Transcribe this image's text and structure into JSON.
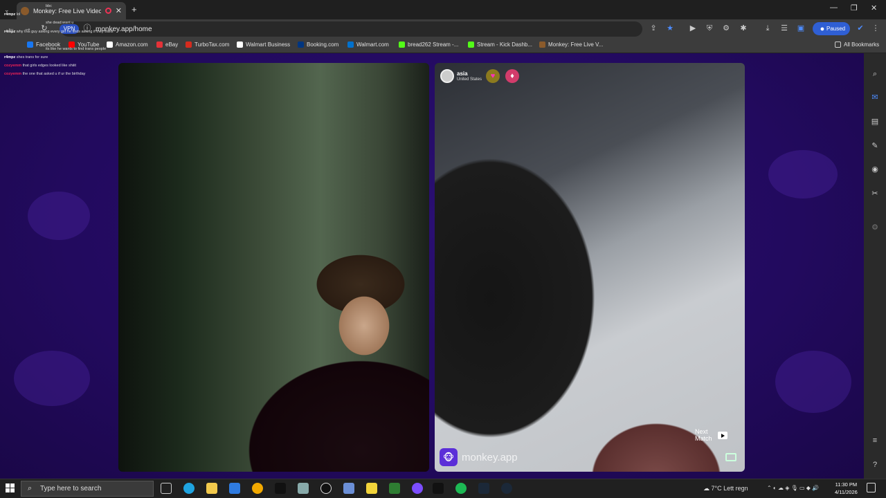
{
  "browser": {
    "tab": {
      "title": "Monkey: Free Live Video Ch",
      "close": "✕"
    },
    "new_tab": "+",
    "window_controls": {
      "minimize": "—",
      "maximize": "❐",
      "close": "✕"
    },
    "address": {
      "vpn_label": "VPN",
      "url": "monkey.app/home"
    },
    "profile_label": "Paused",
    "bookmarks": [
      {
        "label": "Facebook",
        "color": "#1877f2"
      },
      {
        "label": "YouTube",
        "color": "#ff0000"
      },
      {
        "label": "Amazon.com",
        "color": "#ffffff"
      },
      {
        "label": "eBay",
        "color": "#e53238"
      },
      {
        "label": "TurboTax.com",
        "color": "#d52b1e"
      },
      {
        "label": "Walmart Business",
        "color": "#ffffff"
      },
      {
        "label": "Booking.com",
        "color": "#003580"
      },
      {
        "label": "Walmart.com",
        "color": "#0071ce"
      },
      {
        "label": "bread262 Stream -...",
        "color": "#53fc18"
      },
      {
        "label": "Stream - Kick Dashb...",
        "color": "#53fc18"
      },
      {
        "label": "Monkey: Free Live V...",
        "color": "#8a5a2b"
      }
    ],
    "all_bookmarks": "All Bookmarks"
  },
  "chat": [
    {
      "user": "",
      "text": "bbc"
    },
    {
      "user": "r4mpz",
      "text": "lol"
    },
    {
      "user": "",
      "text": "she dead want u"
    },
    {
      "user": "r4mpz",
      "text": "why this guy asking every girl he finds asking if they trans"
    },
    {
      "user": "",
      "text": "its like he wants to find trans people"
    },
    {
      "user": "r4mpz",
      "text": "shes trans for sure"
    },
    {
      "user": "cozyemm",
      "text": "that girls edges looked like shiiit"
    },
    {
      "user": "cozyemm",
      "text": "the one that asked u if ur the birthday"
    }
  ],
  "remote_user": {
    "name": "asia",
    "country": "United States",
    "badges": [
      "heart-badge",
      "monkey-badge"
    ]
  },
  "controls": {
    "next_match_line1": "Next",
    "next_match_line2": "Match",
    "brand": "monkey.app",
    "brand_logo": "🐵"
  },
  "taskbar": {
    "search_placeholder": "Type here to search",
    "weather": "7°C",
    "weather_text": "Lett regn",
    "time": "11:30 PM",
    "date": "4/11/2026"
  },
  "colors": {
    "accent": "#2f5fd4",
    "page_bg": "#220a5e",
    "brand": "#5b2ed8"
  }
}
